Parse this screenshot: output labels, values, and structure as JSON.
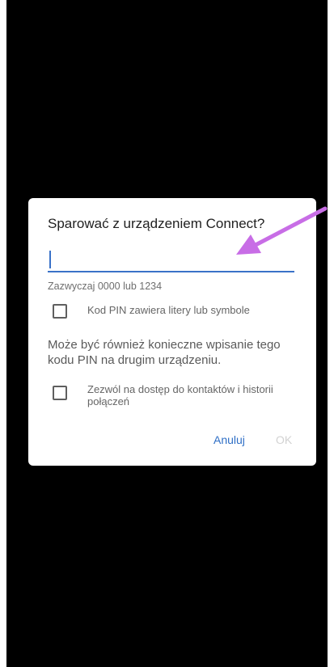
{
  "dialog": {
    "title": "Sparować z urządzeniem Connect?",
    "pin_value": "",
    "hint": "Zazwyczaj 0000 lub 1234",
    "pin_letters_checkbox": {
      "label": "Kod PIN zawiera litery lub symbole",
      "checked": false
    },
    "info_text": "Może być również konieczne wpisanie tego kodu PIN na drugim urządzeniu.",
    "contacts_checkbox": {
      "label": "Zezwól na dostęp do kontaktów i historii połączeń",
      "checked": false
    },
    "cancel_label": "Anuluj",
    "ok_label": "OK"
  },
  "colors": {
    "accent": "#3a72c8",
    "annotation_arrow": "#c86de6",
    "background": "#000000"
  }
}
